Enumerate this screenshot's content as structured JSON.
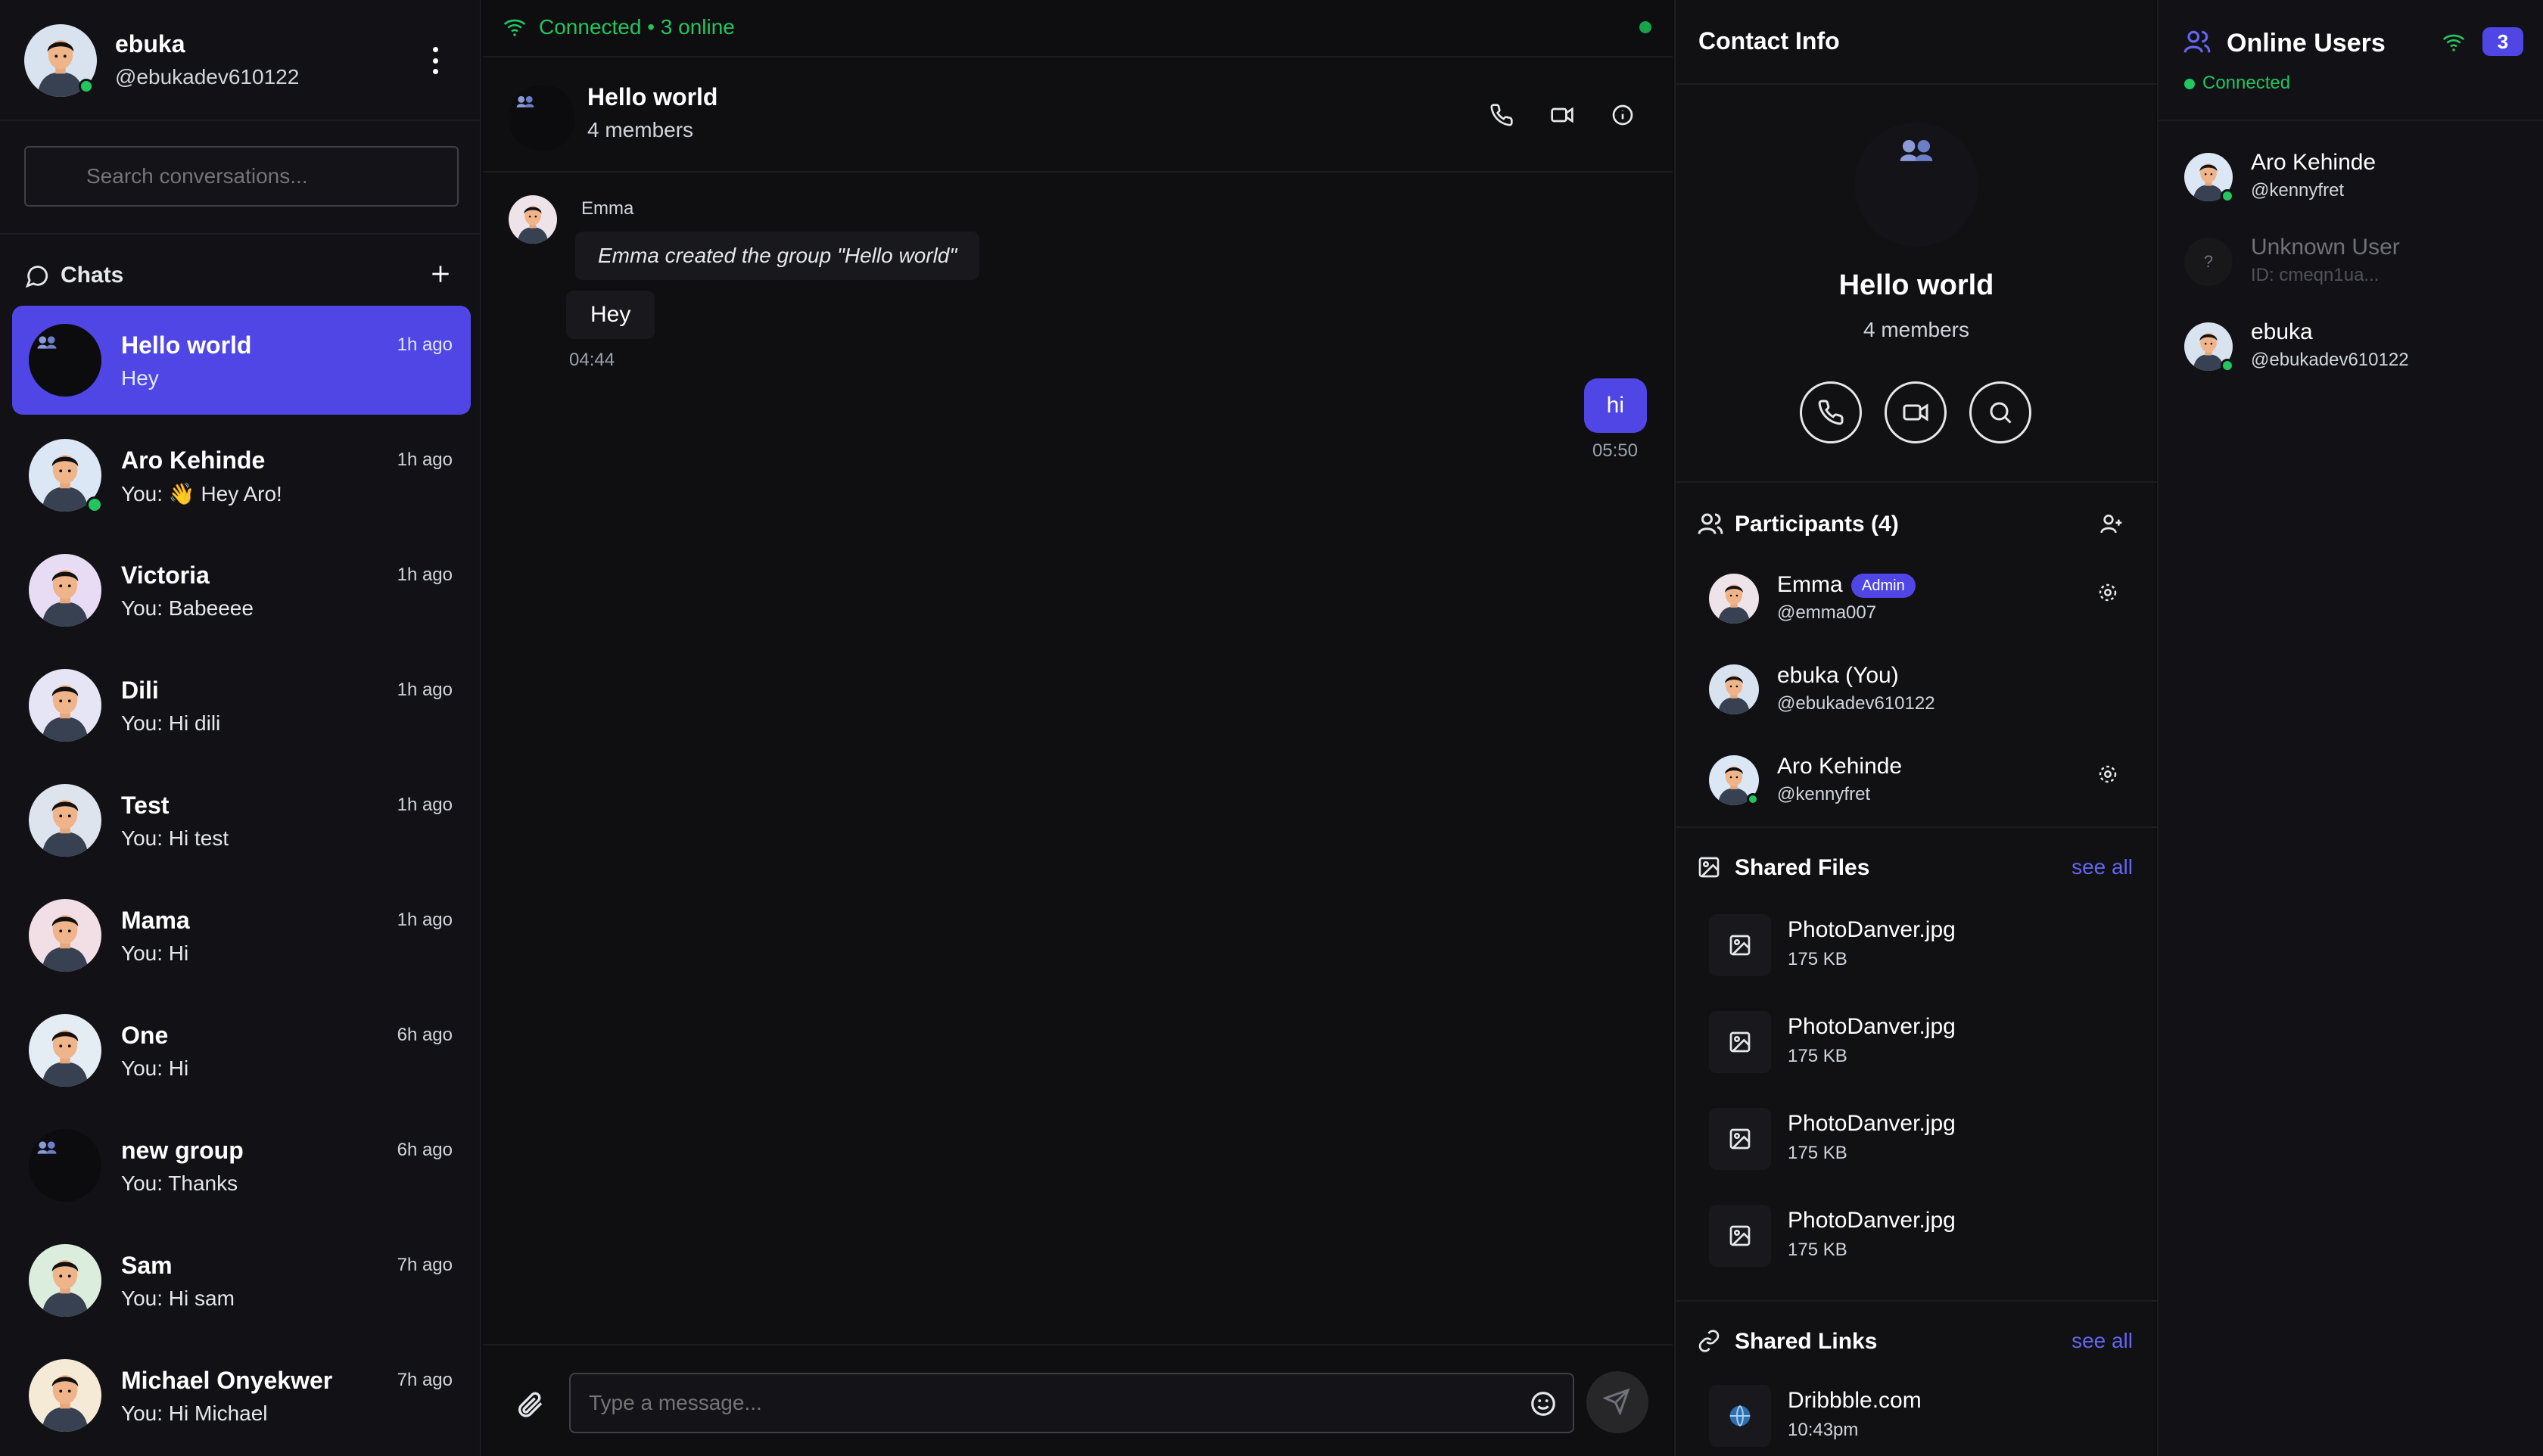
{
  "user": {
    "name": "ebuka",
    "handle": "@ebukadev610122"
  },
  "search": {
    "placeholder": "Search conversations..."
  },
  "chats": {
    "title": "Chats",
    "items": [
      {
        "name": "Hello world",
        "preview": "Hey",
        "time": "1h ago",
        "active": true
      },
      {
        "name": "Aro Kehinde",
        "preview": "You: 👋 Hey Aro!",
        "time": "1h ago"
      },
      {
        "name": "Victoria",
        "preview": "You: Babeeee",
        "time": "1h ago"
      },
      {
        "name": "Dili",
        "preview": "You: Hi dili",
        "time": "1h ago"
      },
      {
        "name": "Test",
        "preview": "You: Hi test",
        "time": "1h ago"
      },
      {
        "name": "Mama",
        "preview": "You: Hi",
        "time": "1h ago"
      },
      {
        "name": "One",
        "preview": "You: Hi",
        "time": "6h ago"
      },
      {
        "name": "new group",
        "preview": "You: Thanks",
        "time": "6h ago"
      },
      {
        "name": "Sam",
        "preview": "You: Hi sam",
        "time": "7h ago"
      },
      {
        "name": "Michael Onyekwer",
        "preview": "You: Hi Michael",
        "time": "7h ago"
      }
    ]
  },
  "connection": {
    "status": "Connected • 3 online"
  },
  "conversation": {
    "title": "Hello world",
    "subtitle": "4 members",
    "messages": {
      "sender": "Emma",
      "system": "Emma created the group \"Hello world\"",
      "incoming_text": "Hey",
      "incoming_time": "04:44",
      "outgoing_text": "hi",
      "outgoing_time": "05:50"
    },
    "composer_placeholder": "Type a message..."
  },
  "contact_info": {
    "title": "Contact Info",
    "name": "Hello world",
    "subtitle": "4 members",
    "participants_title": "Participants (4)",
    "participants": [
      {
        "name": "Emma",
        "handle": "@emma007",
        "badge": "Admin"
      },
      {
        "name": "ebuka (You)",
        "handle": "@ebukadev610122"
      },
      {
        "name": "Aro Kehinde",
        "handle": "@kennyfret"
      }
    ],
    "shared_files_title": "Shared Files",
    "see_all": "see all",
    "files": [
      {
        "name": "PhotoDanver.jpg",
        "size": "175 KB"
      },
      {
        "name": "PhotoDanver.jpg",
        "size": "175 KB"
      },
      {
        "name": "PhotoDanver.jpg",
        "size": "175 KB"
      },
      {
        "name": "PhotoDanver.jpg",
        "size": "175 KB"
      }
    ],
    "shared_links_title": "Shared Links",
    "links": [
      {
        "name": "Dribbble.com",
        "time": "10:43pm"
      }
    ]
  },
  "online_users": {
    "title": "Online Users",
    "count": "3",
    "status": "Connected",
    "users": [
      {
        "name": "Aro Kehinde",
        "handle": "@kennyfret"
      },
      {
        "name": "Unknown User",
        "handle": "ID: cmeqn1ua...",
        "avatar_text": "?"
      },
      {
        "name": "ebuka",
        "handle": "@ebukadev610122"
      }
    ]
  },
  "colors": {
    "accent": "#4f46e5",
    "online": "#22c55e",
    "background": "#0f0f12"
  }
}
